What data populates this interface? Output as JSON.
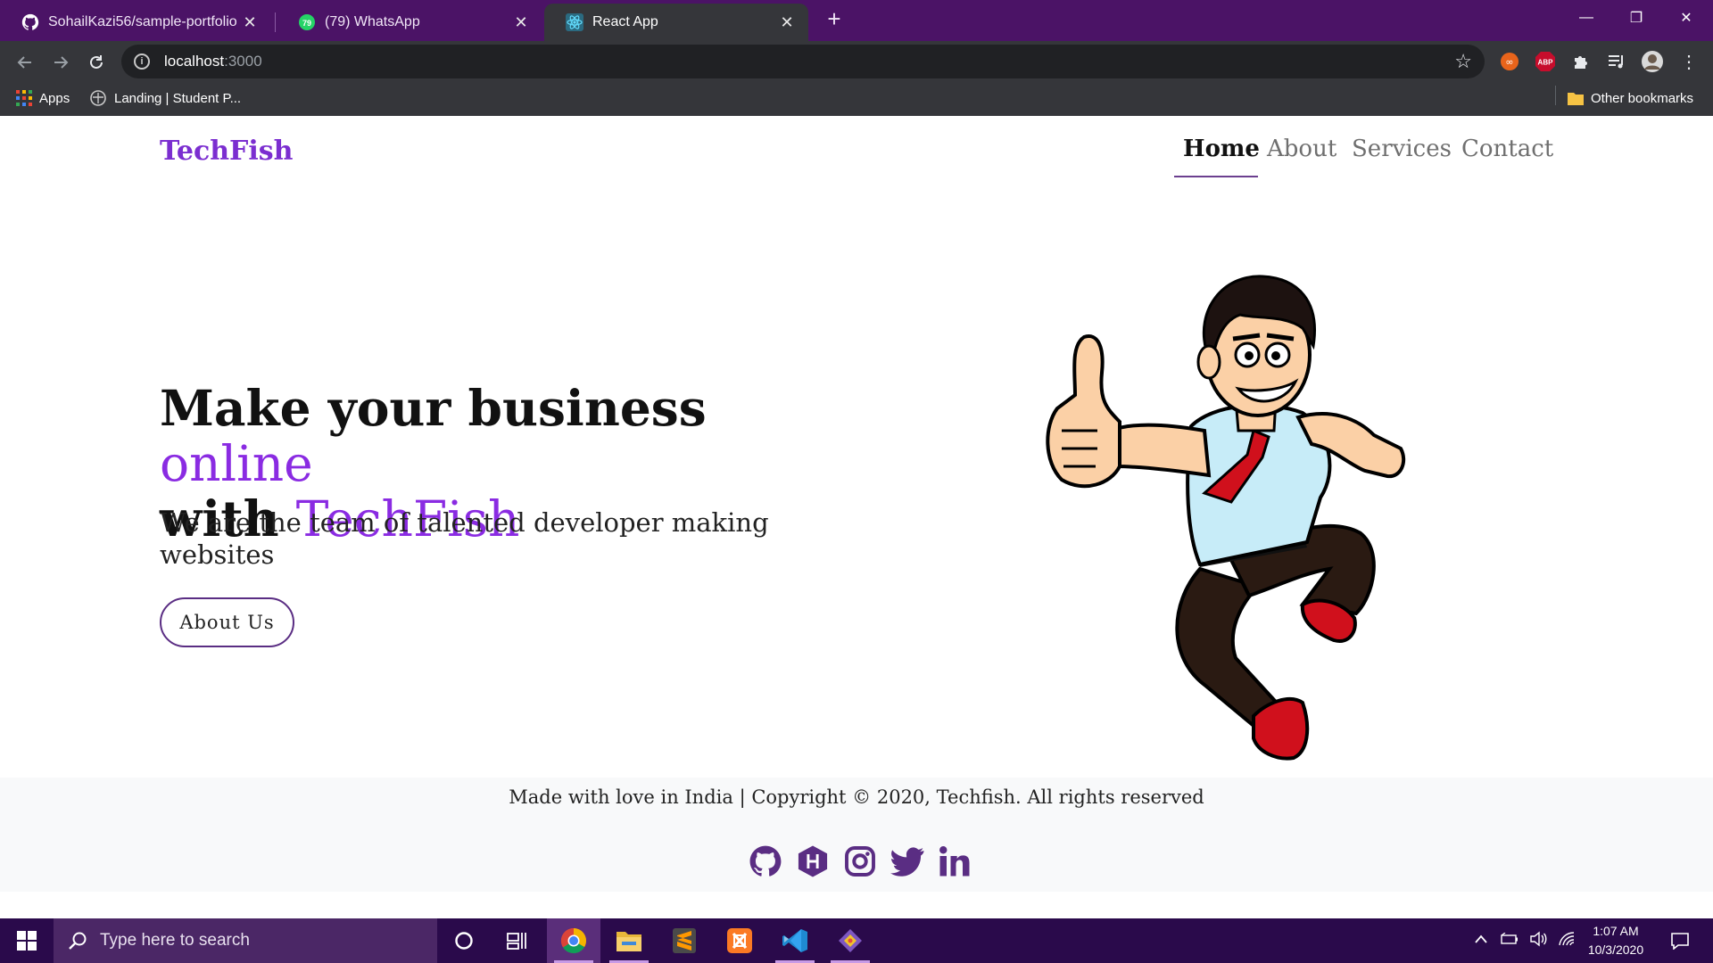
{
  "browser": {
    "tabs": [
      {
        "title": "SohailKazi56/sample-portfolio",
        "icon": "github-icon",
        "close": "✕"
      },
      {
        "title": "(79) WhatsApp",
        "icon": "whatsapp-icon",
        "badge": "79",
        "close": "✕"
      },
      {
        "title": "React App",
        "icon": "react-icon",
        "close": "✕",
        "active": true
      }
    ],
    "new_tab": "+",
    "window_controls": {
      "minimize": "—",
      "restore": "❐",
      "close": "✕"
    },
    "url_host": "localhost",
    "url_port": ":3000",
    "bookmarks": [
      {
        "label": "Apps",
        "icon": "apps-grid-icon"
      },
      {
        "label": "Landing | Student P...",
        "icon": "student-portal-icon"
      }
    ],
    "other_bookmarks": "Other bookmarks"
  },
  "site": {
    "brand": "TechFish",
    "nav": [
      {
        "label": "Home",
        "active": true
      },
      {
        "label": "About"
      },
      {
        "label": "Services"
      },
      {
        "label": "Contact"
      }
    ],
    "hero": {
      "title_part1": "Make your business ",
      "title_accent1": "online",
      "title_part2": "with ",
      "title_accent2": "TechFish",
      "subtitle": "We are the team of talented developer making websites",
      "button": "About Us"
    },
    "footer": {
      "text": "Made with love in India | Copyright © 2020, Techfish. All rights reserved",
      "socials": [
        "github-icon",
        "hashnode-icon",
        "instagram-icon",
        "twitter-icon",
        "linkedin-icon"
      ]
    },
    "colors": {
      "accent": "#8a2be2",
      "brand": "#7b2ed0",
      "button_border": "#5a2d83"
    }
  },
  "taskbar": {
    "search_placeholder": "Type here to search",
    "pinned": [
      "cortana-icon",
      "task-view-icon",
      "chrome-icon",
      "file-explorer-icon",
      "sublime-text-icon",
      "xampp-icon",
      "vscode-icon",
      "git-icon"
    ],
    "time": "1:07 AM",
    "date": "10/3/2020"
  }
}
